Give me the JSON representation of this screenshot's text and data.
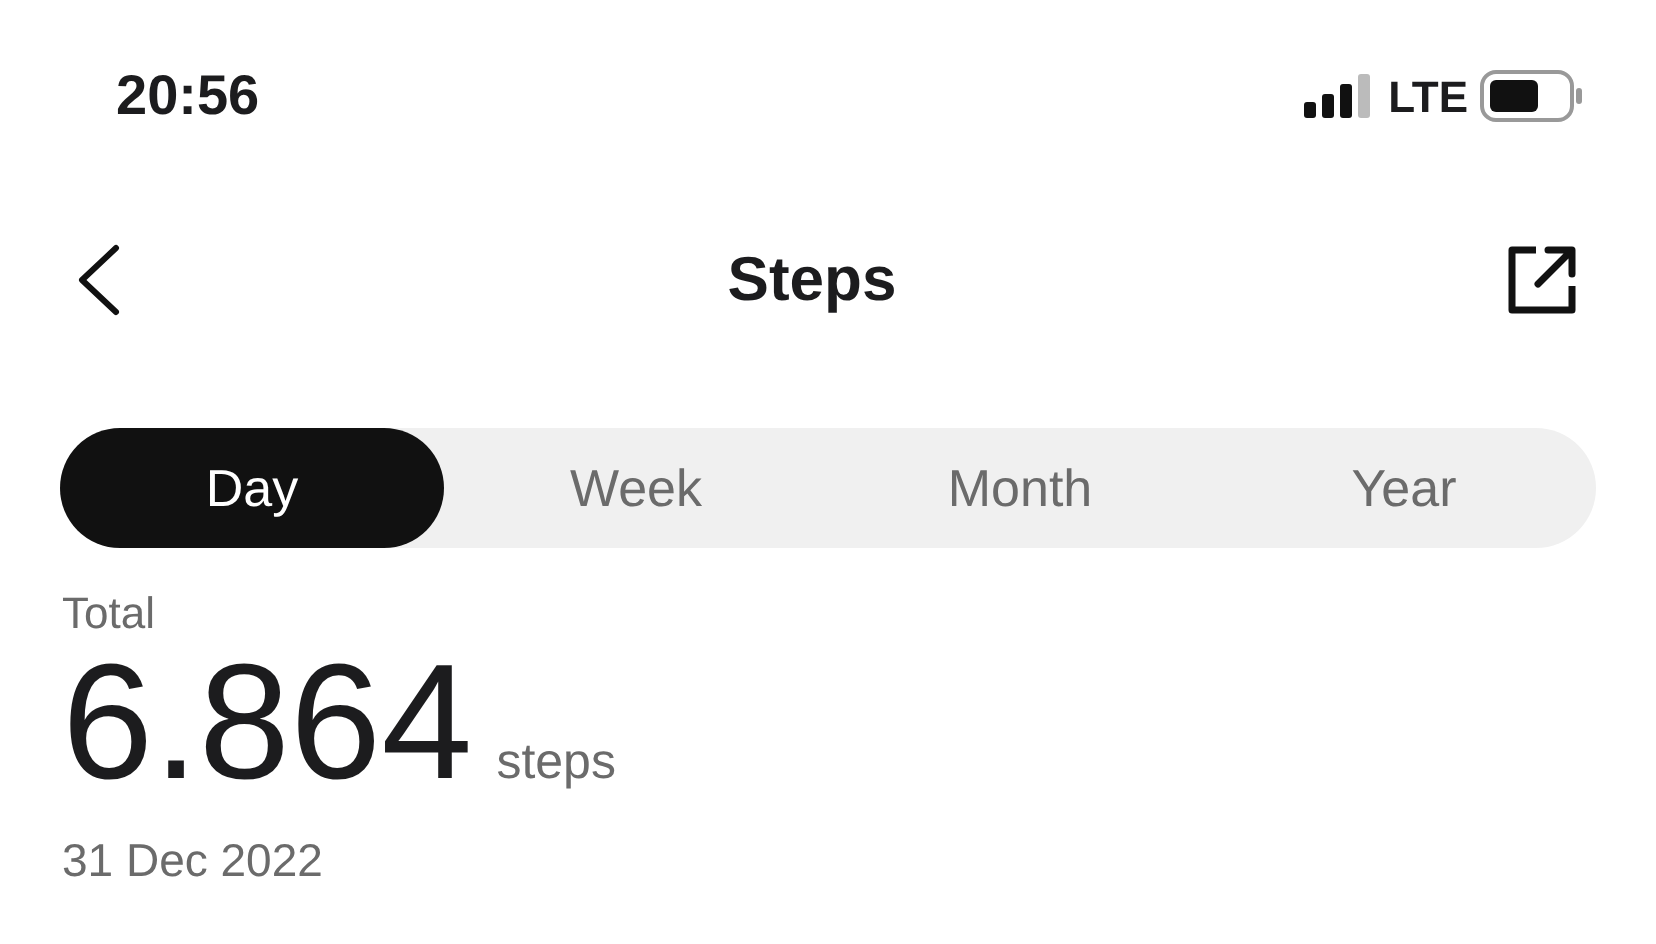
{
  "status_bar": {
    "time": "20:56",
    "network": "LTE"
  },
  "nav": {
    "title": "Steps"
  },
  "tabs": [
    {
      "label": "Day",
      "selected": true
    },
    {
      "label": "Week",
      "selected": false
    },
    {
      "label": "Month",
      "selected": false
    },
    {
      "label": "Year",
      "selected": false
    }
  ],
  "summary": {
    "label": "Total",
    "value": "6.864",
    "unit": "steps",
    "date": "31 Dec 2022"
  }
}
